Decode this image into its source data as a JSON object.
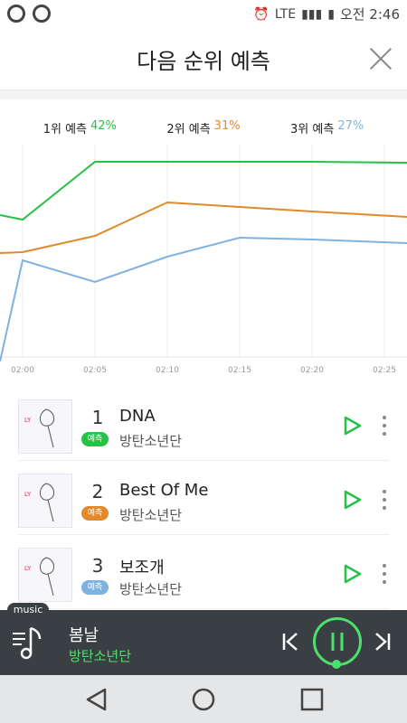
{
  "status_bar": {
    "time": "오전 2:46",
    "lte": "LTE"
  },
  "header": {
    "title": "다음 순위 예측"
  },
  "legend": [
    {
      "label": "1위 예측",
      "pct": "42%",
      "color": "#26c247"
    },
    {
      "label": "2위 예측",
      "pct": "31%",
      "color": "#e2892b"
    },
    {
      "label": "3위 예측",
      "pct": "27%",
      "color": "#7fb2de"
    }
  ],
  "chart_data": {
    "type": "line",
    "x": [
      "02:00",
      "02:05",
      "02:10",
      "02:15",
      "02:20",
      "02:25"
    ],
    "series": [
      {
        "color": "#26c247",
        "values": [
          null,
          null,
          null,
          null,
          null,
          null
        ]
      },
      {
        "color": "#e2892b",
        "values": [
          null,
          null,
          null,
          null,
          null,
          null
        ]
      },
      {
        "color": "#7fb2de",
        "values": [
          null,
          null,
          null,
          null,
          null,
          null
        ]
      }
    ],
    "grid": "vertical"
  },
  "songs": [
    {
      "rank": "1",
      "title": "DNA",
      "artist": "방탄소년단",
      "badge": "예측",
      "badge_color": "#26c247"
    },
    {
      "rank": "2",
      "title": "Best Of Me",
      "artist": "방탄소년단",
      "badge": "예측",
      "badge_color": "#e2892b"
    },
    {
      "rank": "3",
      "title": "보조개",
      "artist": "방탄소년단",
      "badge": "예측",
      "badge_color": "#7fb2de"
    }
  ],
  "player": {
    "tag": "music",
    "title": "봄날",
    "artist": "방탄소년단",
    "accent": "#4ee06c"
  },
  "icons": {
    "close": "close-icon",
    "play": "play-icon",
    "more": "more-vertical-icon",
    "prev": "skip-previous-icon",
    "next": "skip-next-icon",
    "pause": "pause-icon",
    "playlist": "playlist-music-icon",
    "back": "back-icon",
    "home": "home-icon",
    "recent": "recent-apps-icon"
  }
}
